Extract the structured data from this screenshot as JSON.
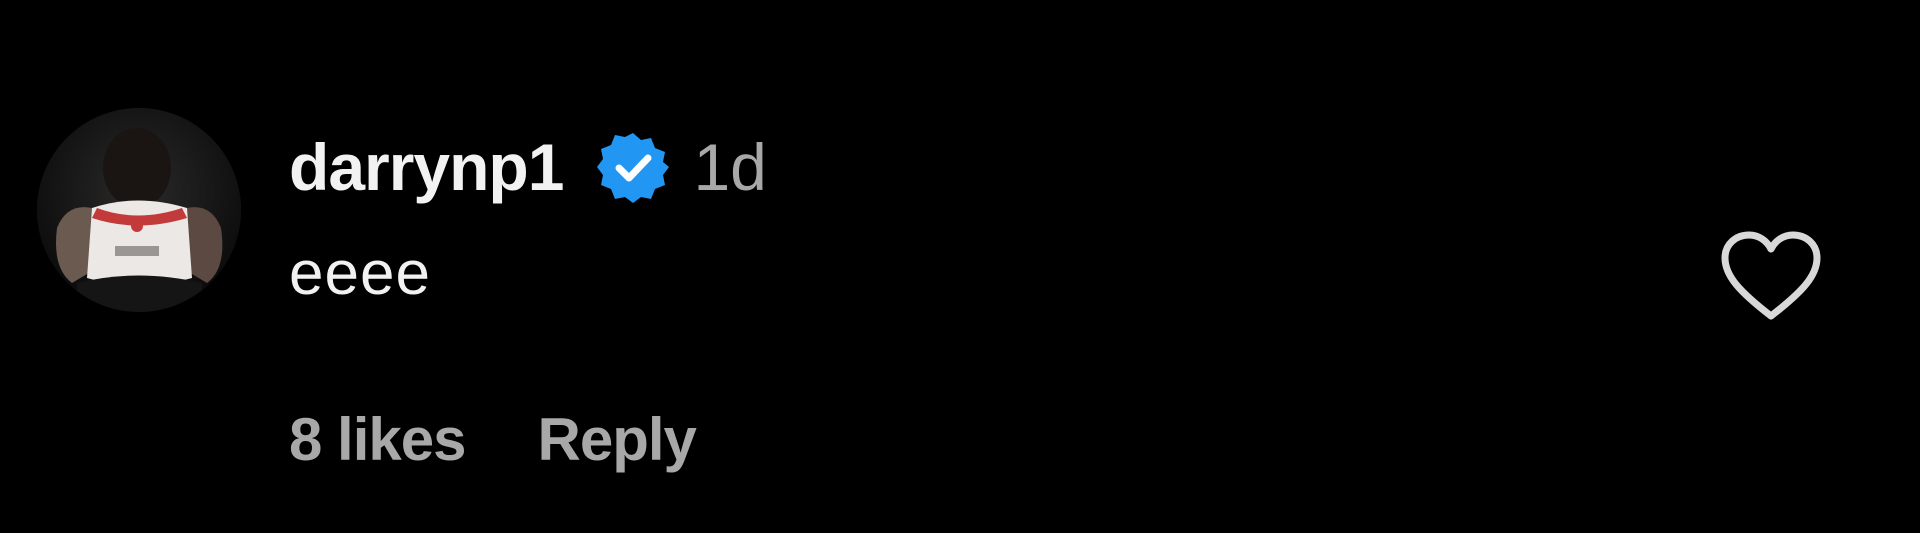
{
  "comment": {
    "username": "darrynp1",
    "verified": true,
    "timestamp": "1d",
    "text": "eeee",
    "likes_label": "8 likes",
    "reply_label": "Reply"
  },
  "icons": {
    "avatar": "profile-photo",
    "verified": "verified-badge-icon",
    "like": "heart-outline-icon"
  },
  "colors": {
    "background": "#000000",
    "primary_text": "#f2f2f2",
    "secondary_text": "#a8a8a8",
    "verified_blue": "#2196f3"
  }
}
